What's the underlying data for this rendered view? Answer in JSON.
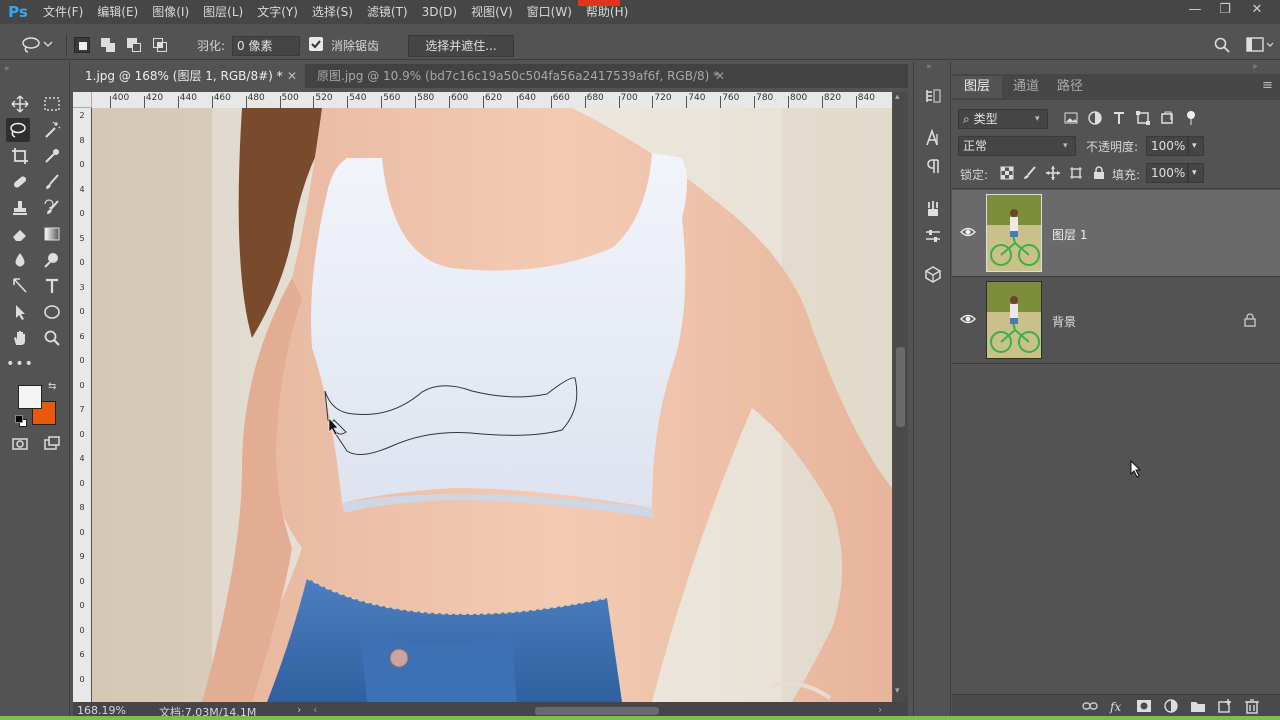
{
  "app": {
    "logo": "Ps"
  },
  "menu": [
    "文件(F)",
    "编辑(E)",
    "图像(I)",
    "图层(L)",
    "文字(Y)",
    "选择(S)",
    "滤镜(T)",
    "3D(D)",
    "视图(V)",
    "窗口(W)",
    "帮助(H)"
  ],
  "window_controls": {
    "minimize": "—",
    "restore": "❐",
    "close": "✕"
  },
  "options": {
    "feather_label": "羽化:",
    "feather_value": "0 像素",
    "antialias_label": "消除锯齿",
    "antialias_checked": true,
    "select_mask_button": "选择并遮住..."
  },
  "tabs": [
    {
      "title": "1.jpg @ 168% (图层 1, RGB/8#) *",
      "active": true
    },
    {
      "title": "原图.jpg @ 10.9% (bd7c16c19a50c504fa56a2417539af6f, RGB/8) *",
      "active": false
    }
  ],
  "ruler_top": [
    "400",
    "420",
    "440",
    "460",
    "480",
    "500",
    "520",
    "540",
    "560",
    "580",
    "600",
    "620",
    "640",
    "660",
    "680",
    "700",
    "720",
    "740",
    "760",
    "780",
    "800",
    "820",
    "840"
  ],
  "ruler_left": [
    "2",
    "8",
    "0",
    "4",
    "0",
    "5",
    "0",
    "3",
    "0",
    "6",
    "0",
    "0",
    "7",
    "0",
    "4",
    "0",
    "8",
    "0",
    "9",
    "0",
    "0",
    "0",
    "6",
    "0"
  ],
  "status": {
    "zoom": "168.19%",
    "doc": "文档:7.03M/14.1M"
  },
  "colors": {
    "foreground": "#f5f5f5",
    "background": "#e8590c",
    "app_bg": "#535353",
    "accent_green": "#7cc242"
  },
  "layers_panel": {
    "tabs": [
      "图层",
      "通道",
      "路径"
    ],
    "filter_kind": "类型",
    "blend_mode": "正常",
    "opacity_label": "不透明度:",
    "opacity_value": "100%",
    "lock_label": "锁定:",
    "fill_label": "填充:",
    "fill_value": "100%",
    "layers": [
      {
        "name": "图层 1",
        "visible": true,
        "selected": true,
        "locked": false
      },
      {
        "name": "背景",
        "visible": true,
        "selected": false,
        "locked": true
      }
    ]
  }
}
